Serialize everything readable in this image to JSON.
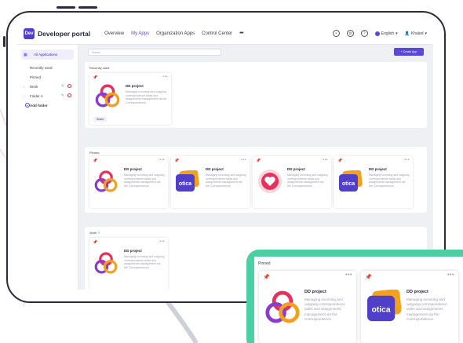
{
  "header": {
    "logo_text": "Dev",
    "brand": "Developer portal",
    "nav": [
      "Overview",
      "My Apps",
      "Organization Apps",
      "Control Center",
      "•••"
    ],
    "language": "English",
    "user": "Khaled"
  },
  "sidebar": {
    "items": [
      {
        "label": "All Applications"
      },
      {
        "label": "Recently used"
      },
      {
        "label": "Pinned"
      },
      {
        "label": "Work"
      },
      {
        "label": "Folder A"
      },
      {
        "label": "Add folder"
      }
    ]
  },
  "main": {
    "search_placeholder": "Search",
    "create_button": "+ Create App",
    "sections": [
      {
        "title": "Recently used"
      },
      {
        "title": "Pinned"
      },
      {
        "title": "Work"
      }
    ]
  },
  "app": {
    "title": "DD project",
    "description": "Managing incoming and outgoing correspondence tasks and assignments management via the Correspondence.",
    "share_label": "Share",
    "otica_text": "otica"
  },
  "zoom": {
    "title": "Pinned",
    "cards": [
      {
        "title": "DD project",
        "description": "Managing incoming and outgoing correspondence tasks and assignments management via the Correspondence."
      },
      {
        "title": "DD project",
        "description": "Managing incoming and outgoing correspondence tasks and assignments management via the Correspondence."
      }
    ]
  },
  "colors": {
    "accent": "#5a48d6",
    "zoom_bg": "#4ccfa3",
    "frame": "#2a2c3b"
  }
}
